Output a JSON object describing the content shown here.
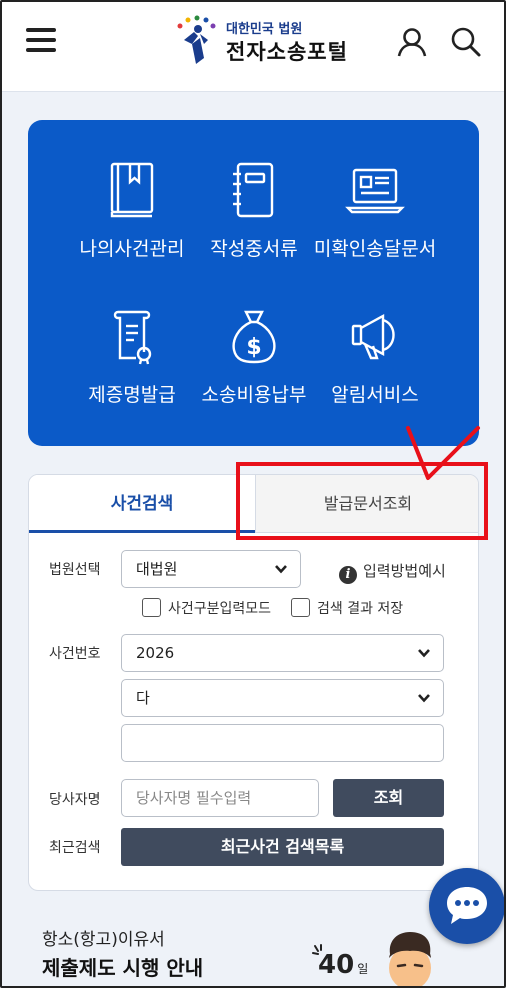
{
  "header": {
    "logo_subtitle": "대한민국 법원",
    "logo_title": "전자소송포털"
  },
  "services": {
    "items": [
      {
        "label": "나의사건관리",
        "icon": "book-icon"
      },
      {
        "label": "작성중서류",
        "icon": "notebook-icon"
      },
      {
        "label": "미확인송달문서",
        "icon": "laptop-document-icon"
      },
      {
        "label": "제증명발급",
        "icon": "certificate-icon"
      },
      {
        "label": "소송비용납부",
        "icon": "money-bag-icon"
      },
      {
        "label": "알림서비스",
        "icon": "megaphone-icon"
      }
    ]
  },
  "search": {
    "tabs": [
      {
        "label": "사건검색",
        "active": true
      },
      {
        "label": "발급문서조회",
        "active": false
      }
    ],
    "court_label": "법원선택",
    "court_value": "대법원",
    "help_label": "입력방법예시",
    "checkbox_mode": "사건구분입력모드",
    "checkbox_save": "검색 결과 저장",
    "case_no_label": "사건번호",
    "year_value": "2026",
    "type_value": "다",
    "case_number_value": "",
    "party_label": "당사자명",
    "party_placeholder": "당사자명 필수입력",
    "query_button": "조회",
    "recent_label": "최근검색",
    "recent_button": "최근사건 검색목록"
  },
  "banner": {
    "line1": "항소(항고)이유서",
    "line2": "제출제도 시행 안내",
    "days_number": "40",
    "days_unit": "일"
  },
  "colors": {
    "brand_blue": "#0b5ac8",
    "active_tab": "#1a4fa8",
    "dark_button": "#404b5e",
    "annotation_red": "#e8101a"
  }
}
